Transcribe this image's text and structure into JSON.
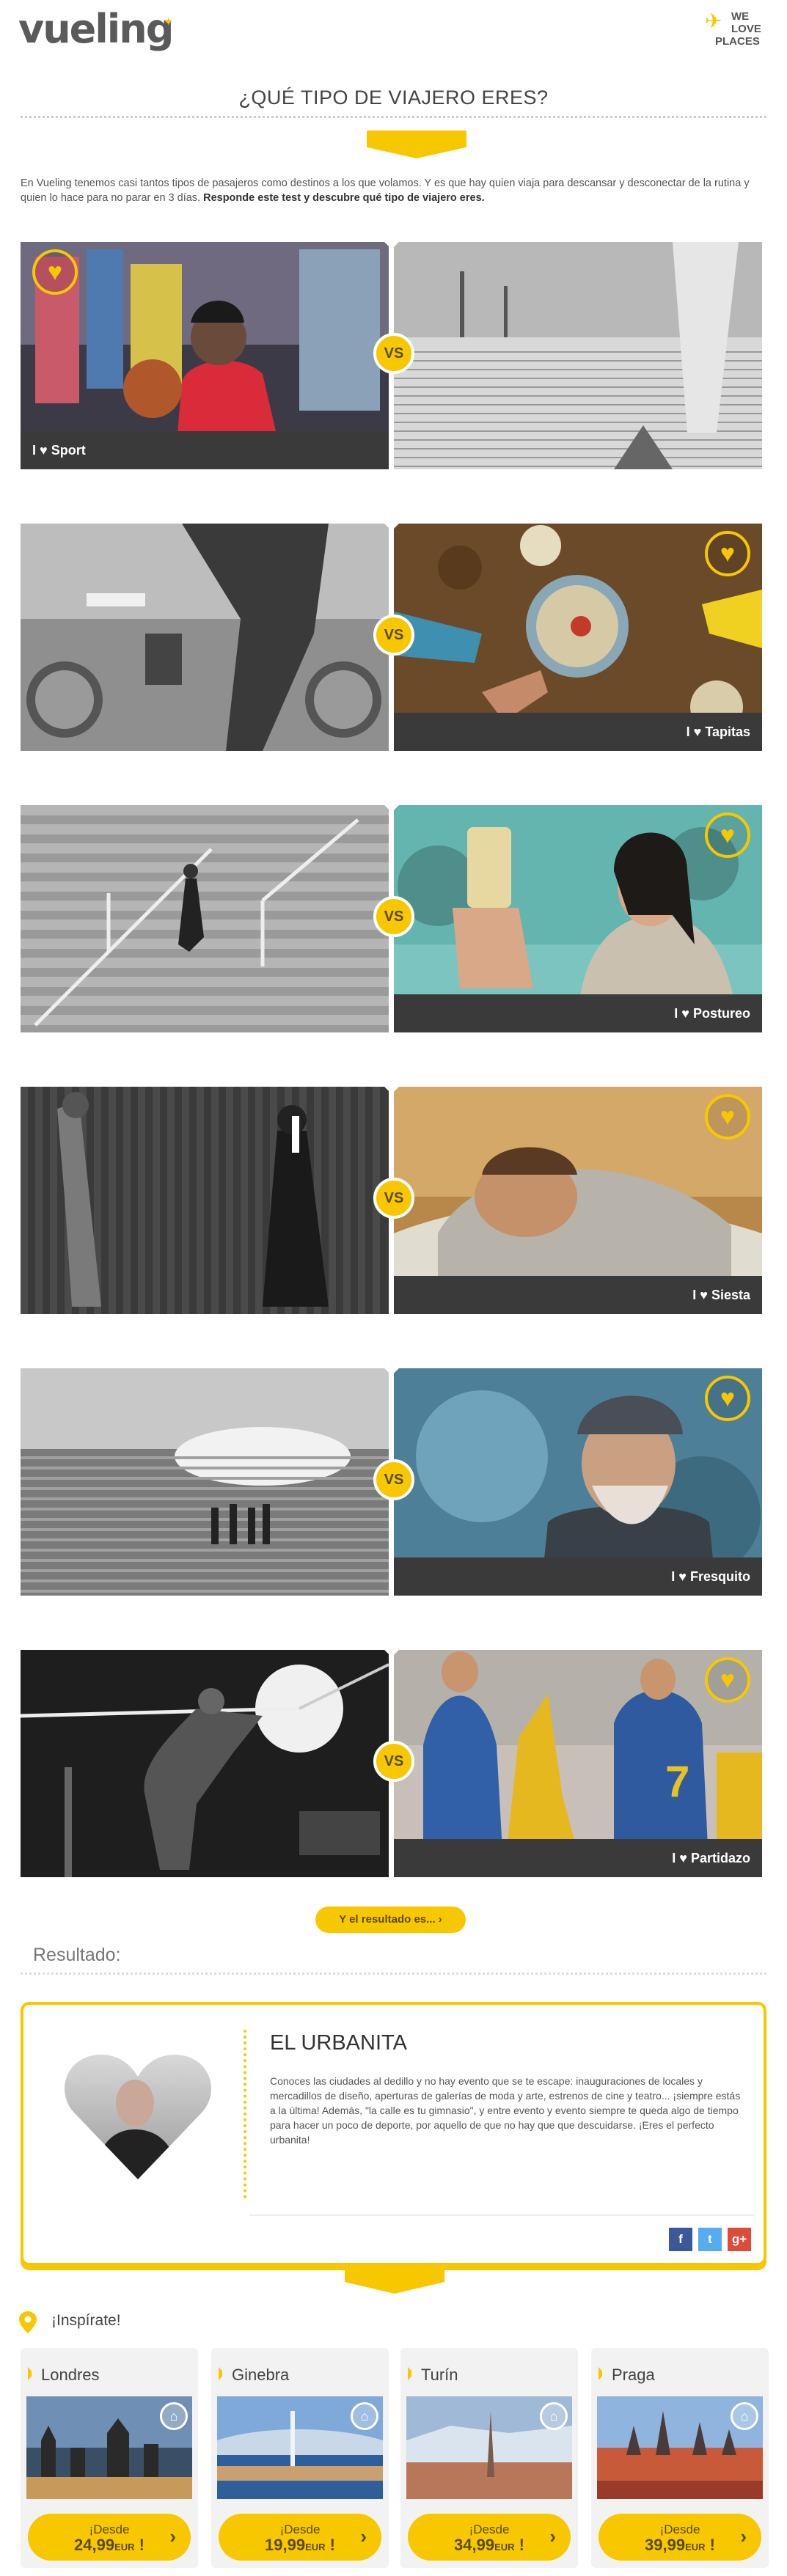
{
  "header": {
    "logo": "vueling",
    "badge_line1": "WE",
    "badge_line2": "LOVE",
    "badge_line3": "PLACES"
  },
  "quiz": {
    "title": "¿QUÉ TIPO DE VIAJERO ERES?",
    "intro_plain": "En Vueling tenemos casi tantos tipos de pasajeros como destinos a los que volamos. Y es que hay quien viaja para descansar y desconectar de la rutina y quien lo hace para no parar en 3 días. ",
    "intro_bold": "Responde este test y descubre qué tipo de viajero eres.",
    "vs_label": "VS",
    "love_prefix": "I",
    "pairs": [
      {
        "selected": "left",
        "label": "Sport"
      },
      {
        "selected": "right",
        "label": "Tapitas"
      },
      {
        "selected": "right",
        "label": "Postureo"
      },
      {
        "selected": "right",
        "label": "Siesta"
      },
      {
        "selected": "right",
        "label": "Fresquito"
      },
      {
        "selected": "right",
        "label": "Partidazo"
      }
    ],
    "result_button": "Y el resultado es..."
  },
  "result": {
    "heading": "Resultado:",
    "title": "EL URBANITA",
    "text": "Conoces las ciudades al dedillo y no hay evento que se te escape: inauguraciones de locales y mercadillos de diseño, aperturas de galerías de moda y arte, estrenos de cine y teatro... ¡siempre estás a la última! Además, \"la calle es tu gimnasio\", y entre evento y evento siempre te queda algo de tiempo para hacer un poco de deporte, por aquello de que no hay que que descuidarse. ¡Eres el perfecto urbanita!",
    "social": [
      "f",
      "t",
      "g+"
    ],
    "social_colors": [
      "#3b5998",
      "#55acee",
      "#dd4b39"
    ]
  },
  "inspirate": {
    "heading": "¡Inspírate!",
    "cards": [
      {
        "city": "Londres",
        "line1": "¡Desde",
        "price": "24,99",
        "currency": "EUR",
        "end": "!"
      },
      {
        "city": "Ginebra",
        "line1": "¡Desde",
        "price": "19,99",
        "currency": "EUR",
        "end": "!"
      },
      {
        "city": "Turín",
        "line1": "¡Desde",
        "price": "34,99",
        "currency": "EUR",
        "end": "!"
      },
      {
        "city": "Praga",
        "line1": "¡Desde",
        "price": "39,99",
        "currency": "EUR",
        "end": "!"
      }
    ]
  },
  "colors": {
    "accent": "#f7c800",
    "bar": "#3a3a3a"
  }
}
